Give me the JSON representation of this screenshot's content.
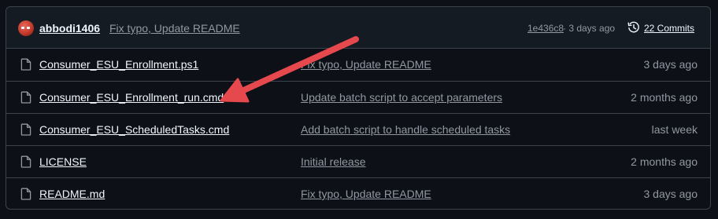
{
  "header": {
    "author": "abbodi1406",
    "commit_message": "Fix typo, Update README",
    "commit_hash": "1e436c8",
    "time_text": " · 3 days ago",
    "commits_label": "22 Commits"
  },
  "files": [
    {
      "name": "Consumer_ESU_Enrollment.ps1",
      "message": "Fix typo, Update README",
      "time": "3 days ago"
    },
    {
      "name": "Consumer_ESU_Enrollment_run.cmd",
      "message": "Update batch script to accept parameters",
      "time": "2 months ago"
    },
    {
      "name": "Consumer_ESU_ScheduledTasks.cmd",
      "message": "Add batch script to handle scheduled tasks",
      "time": "last week"
    },
    {
      "name": "LICENSE",
      "message": "Initial release",
      "time": "2 months ago"
    },
    {
      "name": "README.md",
      "message": "Fix typo, Update README",
      "time": "3 days ago"
    }
  ],
  "icons": {
    "avatar": "avatar-icon",
    "history": "history-icon",
    "file": "file-icon",
    "annotation": "red-arrow-annotation"
  },
  "colors": {
    "background": "#0d1117",
    "header_bg": "#151b23",
    "border": "#3d444d",
    "text_primary": "#f0f6fc",
    "text_muted": "#9198a1",
    "arrow": "#e5484d"
  }
}
